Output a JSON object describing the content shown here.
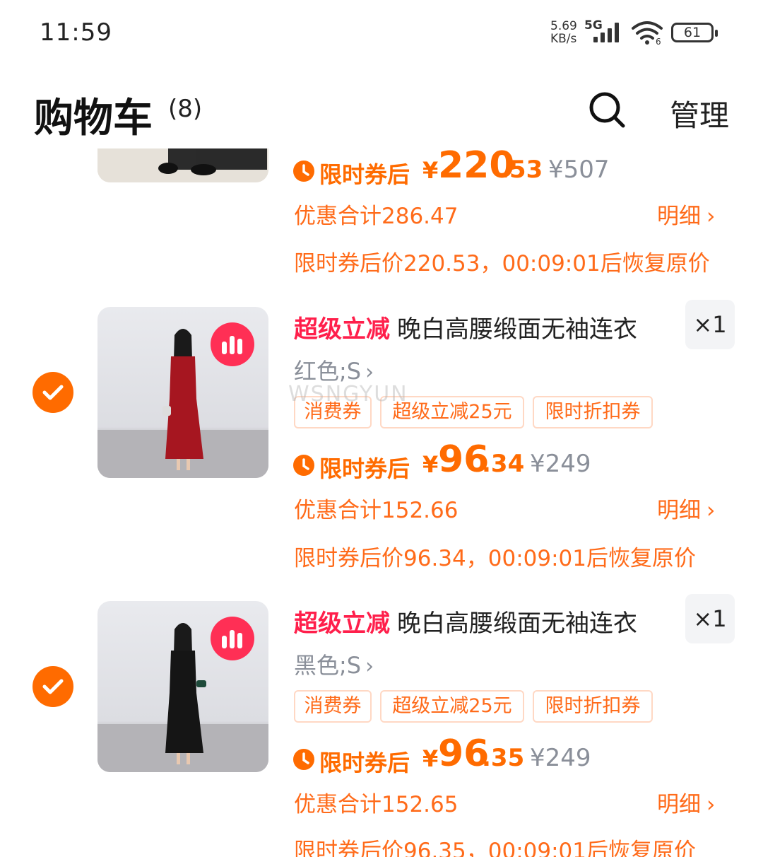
{
  "status_bar": {
    "time": "11:59",
    "net_speed": "5.69",
    "net_unit": "KB/s",
    "network": "5G",
    "wifi_level": "6",
    "battery": "61"
  },
  "header": {
    "title": "购物车",
    "count": "(8)",
    "search_icon": "search-icon",
    "manage_label": "管理"
  },
  "watermark": "WSNGYUN",
  "items": [
    {
      "price_label": "限时券后",
      "currency": "¥",
      "price_int": "220",
      "price_dec": ".53",
      "price_orig": "¥507",
      "discount_total": "优惠合计286.47",
      "detail_label": "明细",
      "notice": "限时券后价220.53，00:09:01后恢复原价"
    },
    {
      "tag": "超级立减",
      "title": "晚白高腰缎面无袖连衣",
      "quantity": "×1",
      "variant": "红色;S",
      "coupons": [
        "消费券",
        "超级立减25元",
        "限时折扣券"
      ],
      "price_label": "限时券后",
      "currency": "¥",
      "price_int": "96",
      "price_dec": ".34",
      "price_orig": "¥249",
      "discount_total": "优惠合计152.66",
      "detail_label": "明细",
      "notice": "限时券后价96.34，00:09:01后恢复原价",
      "dress_color": "#a61620",
      "checked": true
    },
    {
      "tag": "超级立减",
      "title": "晚白高腰缎面无袖连衣",
      "quantity": "×1",
      "variant": "黑色;S",
      "coupons": [
        "消费券",
        "超级立减25元",
        "限时折扣券"
      ],
      "price_label": "限时券后",
      "currency": "¥",
      "price_int": "96",
      "price_dec": ".35",
      "price_orig": "¥249",
      "discount_total": "优惠合计152.65",
      "detail_label": "明细",
      "notice": "限时券后价96.35，00:09:01后恢复原价",
      "dress_color": "#151515",
      "checked": true
    }
  ],
  "colors": {
    "accent": "#ff6b00",
    "tag_red": "#ff1f4b",
    "muted": "#8a8f99"
  }
}
